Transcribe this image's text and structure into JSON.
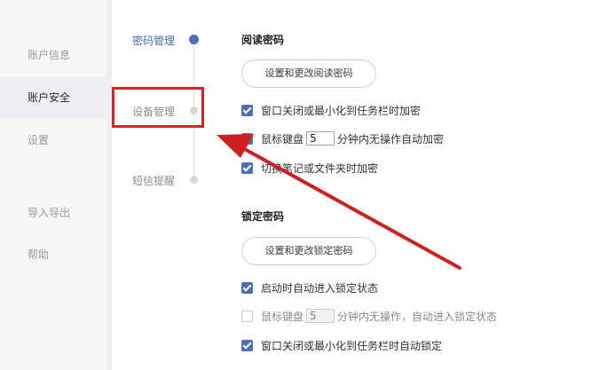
{
  "sidebar": {
    "items": [
      {
        "label": "账户信息"
      },
      {
        "label": "账户安全"
      },
      {
        "label": "设置"
      },
      {
        "label": "导入导出"
      },
      {
        "label": "帮助"
      }
    ]
  },
  "subnav": {
    "items": [
      {
        "label": "密码管理"
      },
      {
        "label": "设备管理"
      },
      {
        "label": "短信提醒"
      }
    ]
  },
  "read_password": {
    "title": "阅读密码",
    "button_label": "设置和更改阅读密码",
    "opt1": "窗口关闭或最小化到任务栏时加密",
    "opt2_prefix": "鼠标键盘",
    "opt2_value": "5",
    "opt2_suffix": "分钟内无操作自动加密",
    "opt3": "切换笔记或文件夹时加密"
  },
  "lock_password": {
    "title": "锁定密码",
    "button_label": "设置和更改锁定密码",
    "opt1": "启动时自动进入锁定状态",
    "opt2_prefix": "鼠标键盘",
    "opt2_value": "5",
    "opt2_suffix": "分钟内无操作，自动进入锁定状态",
    "opt3": "窗口关闭或最小化到任务栏时自动锁定"
  },
  "colors": {
    "accent": "#4f6db8",
    "highlight": "#e02020",
    "sidebar_bg": "#f7f7f8"
  }
}
